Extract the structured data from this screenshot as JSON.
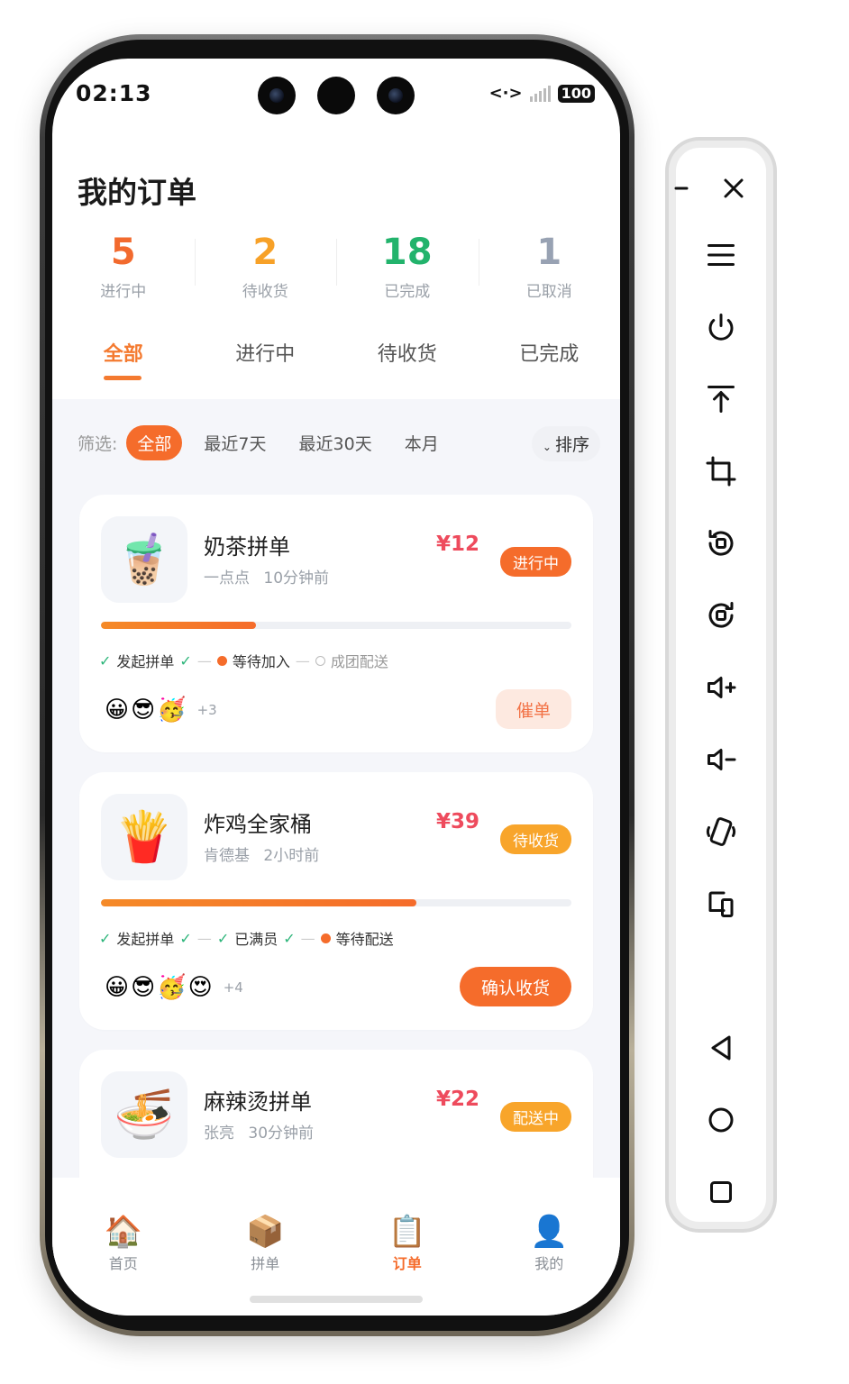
{
  "status_bar": {
    "time": "02:13",
    "battery": "100"
  },
  "page": {
    "title": "我的订单"
  },
  "stats": [
    {
      "value": "5",
      "label": "进行中",
      "color": "#f26a2e"
    },
    {
      "value": "2",
      "label": "待收货",
      "color": "#f7a128"
    },
    {
      "value": "18",
      "label": "已完成",
      "color": "#22b36c"
    },
    {
      "value": "1",
      "label": "已取消",
      "color": "#98a2b3"
    }
  ],
  "tabs": [
    {
      "label": "全部",
      "active": true
    },
    {
      "label": "进行中",
      "active": false
    },
    {
      "label": "待收货",
      "active": false
    },
    {
      "label": "已完成",
      "active": false
    }
  ],
  "filters": {
    "prefix": "筛选:",
    "chips": [
      {
        "label": "全部",
        "active": true
      },
      {
        "label": "最近7天",
        "active": false
      },
      {
        "label": "最近30天",
        "active": false
      },
      {
        "label": "本月",
        "active": false
      }
    ],
    "sort_label": "排序"
  },
  "orders": [
    {
      "icon": "bubble-tea-icon",
      "emoji": "🧋",
      "title": "奶茶拼单",
      "shop": "一点点",
      "time": "10分钟前",
      "price": "¥12",
      "status": "进行中",
      "status_color": "orange",
      "progress": 0.33,
      "steps": [
        "发起拼单",
        "等待加入",
        "成团配送"
      ],
      "avatars": [
        "😀",
        "😎",
        "🥳"
      ],
      "more": "+3",
      "action": "催单"
    },
    {
      "icon": "fries-icon",
      "emoji": "🍟",
      "title": "炸鸡全家桶",
      "shop": "肯德基",
      "time": "2小时前",
      "price": "¥39",
      "status": "待收货",
      "status_color": "yellow",
      "progress": 0.67,
      "steps": [
        "发起拼单",
        "已满员",
        "等待配送"
      ],
      "avatars": [
        "😀",
        "😎",
        "🥳",
        "😍"
      ],
      "more": "+4",
      "action": "确认收货"
    },
    {
      "icon": "noodle-bowl-icon",
      "emoji": "🍜",
      "title": "麻辣烫拼单",
      "shop": "张亮",
      "time": "30分钟前",
      "price": "¥22",
      "status": "配送中",
      "status_color": "yellow"
    }
  ],
  "tabbar": [
    {
      "label": "首页",
      "icon": "house-icon",
      "emoji": "🏠",
      "active": false
    },
    {
      "label": "拼单",
      "icon": "package-icon",
      "emoji": "📦",
      "active": false
    },
    {
      "label": "订单",
      "icon": "clipboard-icon",
      "emoji": "📋",
      "active": true
    },
    {
      "label": "我的",
      "icon": "user-icon",
      "emoji": "👤",
      "active": false
    }
  ],
  "emulator_controls": [
    "minimize-icon",
    "close-icon",
    "menu-icon",
    "power-icon",
    "pin-top-icon",
    "crop-icon",
    "rotate-left-icon",
    "rotate-right-icon",
    "volume-up-icon",
    "volume-down-icon",
    "shake-icon",
    "fold-icon",
    "back-icon",
    "home-icon",
    "recents-icon"
  ]
}
